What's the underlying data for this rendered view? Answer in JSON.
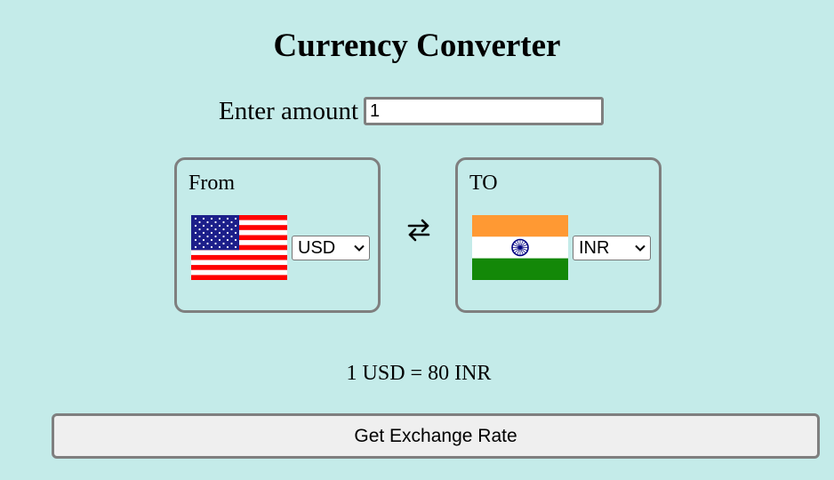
{
  "header": {
    "title": "Currency Converter"
  },
  "amount": {
    "label": "Enter amount",
    "value": "1"
  },
  "from": {
    "label": "From",
    "flag": "us-flag",
    "currency": "USD"
  },
  "to": {
    "label": "TO",
    "flag": "india-flag",
    "currency": "INR"
  },
  "swap_icon": "swap-arrows-icon",
  "result": {
    "text": "1 USD = 80 INR"
  },
  "actions": {
    "get_rate_label": "Get Exchange Rate"
  },
  "colors": {
    "background": "#c4ebe9",
    "border": "#7f7f7f",
    "button_bg": "#efefef"
  }
}
